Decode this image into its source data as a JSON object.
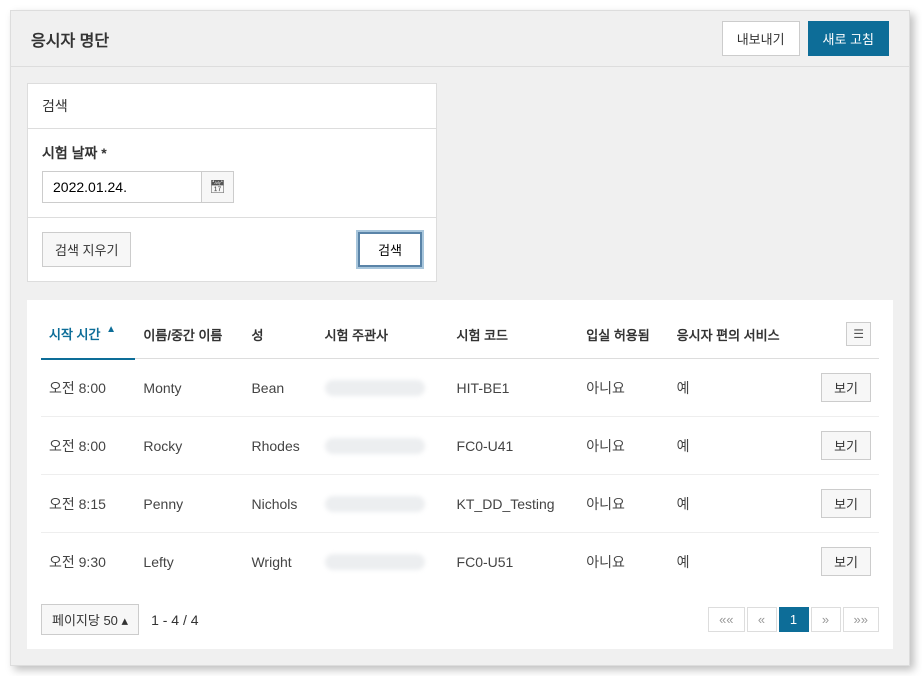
{
  "header": {
    "title": "응시자 명단",
    "export_label": "내보내기",
    "refresh_label": "새로 고침"
  },
  "search": {
    "title": "검색",
    "date_label": "시험 날짜 *",
    "date_value": "2022.01.24.",
    "clear_label": "검색 지우기",
    "submit_label": "검색"
  },
  "columns": {
    "start_time": "시작 시간",
    "first_middle": "이름/중간 이름",
    "last": "성",
    "sponsor": "시험 주관사",
    "exam_code": "시험 코드",
    "admission": "입실 허용됨",
    "accommodation": "응시자 편의 서비스"
  },
  "rows": [
    {
      "start": "오전 8:00",
      "first": "Monty",
      "last": "Bean",
      "code": "HIT-BE1",
      "adm": "아니요",
      "acc": "예",
      "view": "보기"
    },
    {
      "start": "오전 8:00",
      "first": "Rocky",
      "last": "Rhodes",
      "code": "FC0-U41",
      "adm": "아니요",
      "acc": "예",
      "view": "보기"
    },
    {
      "start": "오전 8:15",
      "first": "Penny",
      "last": "Nichols",
      "code": "KT_DD_Testing",
      "adm": "아니요",
      "acc": "예",
      "view": "보기"
    },
    {
      "start": "오전 9:30",
      "first": "Lefty",
      "last": "Wright",
      "code": "FC0-U51",
      "adm": "아니요",
      "acc": "예",
      "view": "보기"
    }
  ],
  "footer": {
    "page_size_label": "페이지당 50 ▴",
    "page_info": "1 - 4 / 4",
    "current_page": "1"
  }
}
